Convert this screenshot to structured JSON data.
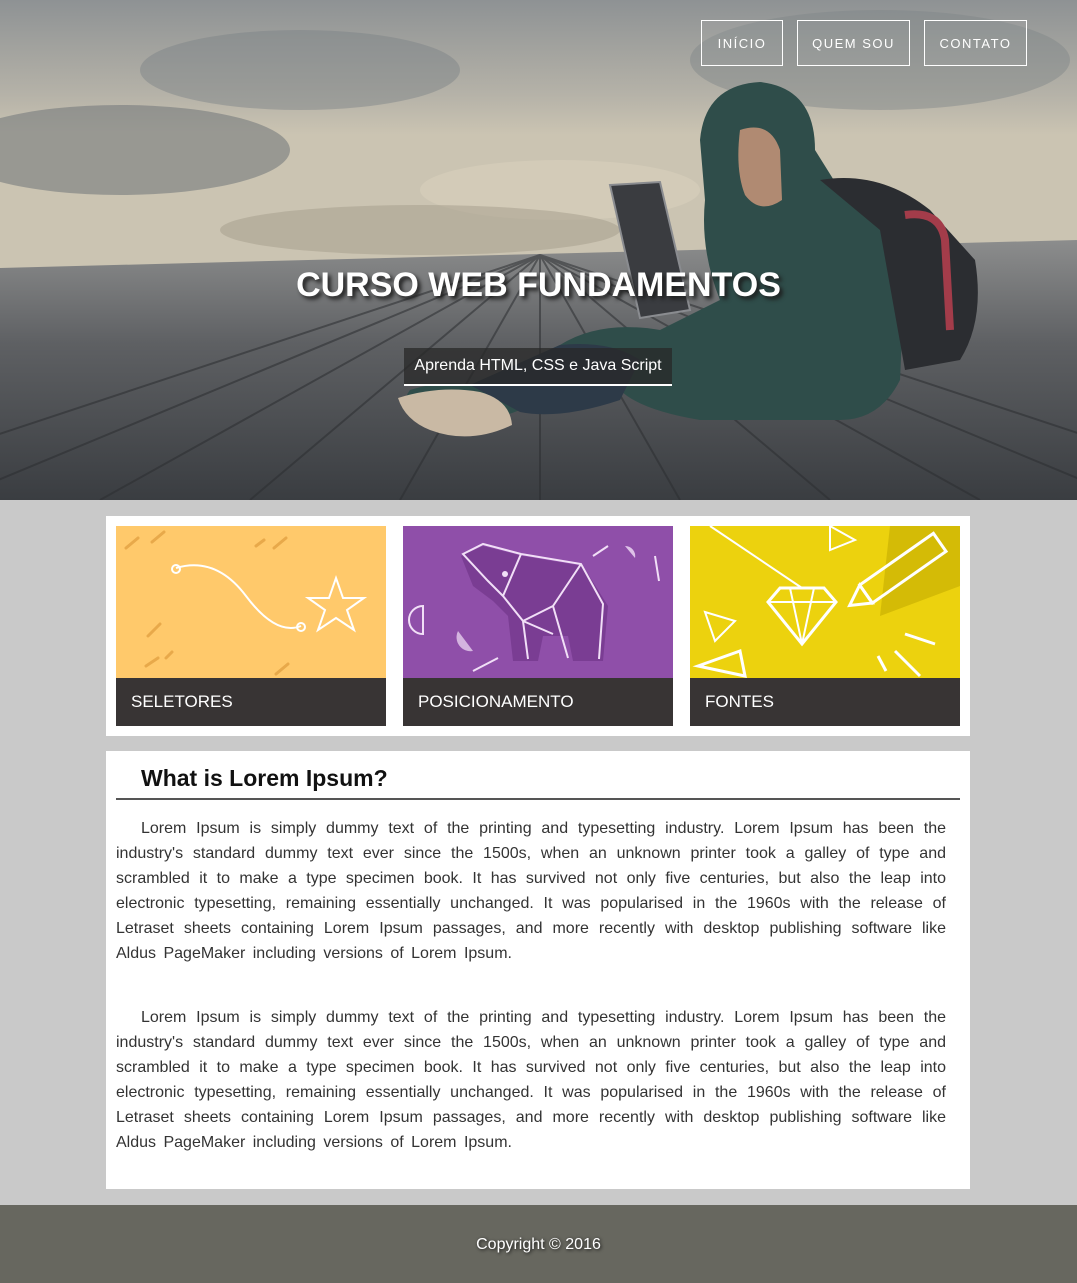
{
  "nav": {
    "items": [
      {
        "label": "INÍCIO"
      },
      {
        "label": "QUEM SOU"
      },
      {
        "label": "CONTATO"
      }
    ]
  },
  "hero": {
    "title": "CURSO WEB FUNDAMENTOS",
    "subtitle": "Aprenda HTML, CSS e Java Script"
  },
  "cards": [
    {
      "label": "SELETORES",
      "icon": "star-path-illustration",
      "color": "#ffc96b"
    },
    {
      "label": "POSICIONAMENTO",
      "icon": "origami-elephant-illustration",
      "color": "#8f4fa9"
    },
    {
      "label": "FONTES",
      "icon": "diamond-pencil-illustration",
      "color": "#ecd20e"
    }
  ],
  "article": {
    "heading": "What is Lorem Ipsum?",
    "paragraphs": [
      "Lorem Ipsum is simply dummy text of the printing and typesetting industry. Lorem Ipsum has been the industry's standard dummy text ever since the 1500s, when an unknown printer took a galley of type and scrambled it to make a type specimen book. It has survived not only five centuries, but also the leap into electronic typesetting, remaining essentially unchanged. It was popularised in the 1960s with the release of Letraset sheets containing Lorem Ipsum passages, and more recently with desktop publishing software like Aldus PageMaker including versions of Lorem Ipsum.",
      "Lorem Ipsum is simply dummy text of the printing and typesetting industry. Lorem Ipsum has been the industry's standard dummy text ever since the 1500s, when an unknown printer took a galley of type and scrambled it to make a type specimen book. It has survived not only five centuries, but also the leap into electronic typesetting, remaining essentially unchanged. It was popularised in the 1960s with the release of Letraset sheets containing Lorem Ipsum passages, and more recently with desktop publishing software like Aldus PageMaker including versions of Lorem Ipsum."
    ]
  },
  "footer": {
    "copyright": "Copyright © 2016"
  },
  "colors": {
    "page_background": "#c9c9c9",
    "caption_background": "#383434",
    "footer_background": "#67675f"
  }
}
